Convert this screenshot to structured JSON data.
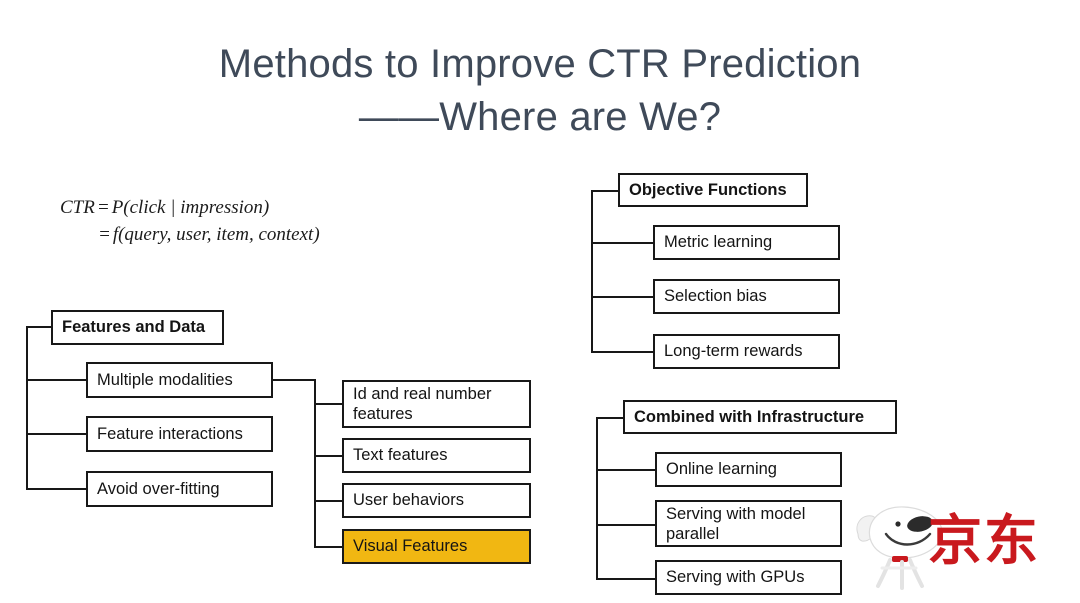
{
  "slide": {
    "title_line1": "Methods to Improve CTR Prediction",
    "title_line2": "——Where are We?",
    "title_color": "#3f4a59",
    "background": "#ffffff"
  },
  "formula": {
    "line1_lhs": "CTR",
    "line1_eq": "=",
    "line1_rhs": "P(click | impression)",
    "line2_eq": "=",
    "line2_rhs": "f(query, user, item, context)"
  },
  "diagram": {
    "line_color": "#181818",
    "highlight_color": "#f1b712",
    "groups": [
      {
        "id": "features-and-data",
        "header": "Features and Data",
        "children": [
          "Multiple modalities",
          "Feature interactions",
          "Avoid over-fitting"
        ]
      },
      {
        "id": "modality-detail",
        "parent": "Multiple modalities",
        "children": [
          "Id and real number features",
          "Text features",
          "User behaviors",
          "Visual Features"
        ],
        "highlighted": "Visual Features"
      },
      {
        "id": "objective-functions",
        "header": "Objective Functions",
        "children": [
          "Metric learning",
          "Selection bias",
          "Long-term rewards"
        ]
      },
      {
        "id": "combined-with-infrastructure",
        "header": "Combined with Infrastructure",
        "children": [
          "Online learning",
          "Serving with model parallel",
          "Serving with GPUs"
        ]
      }
    ]
  },
  "logo": {
    "brand_zh": "京东",
    "brand_color": "#c9191e",
    "mascot": "joy-dog"
  }
}
